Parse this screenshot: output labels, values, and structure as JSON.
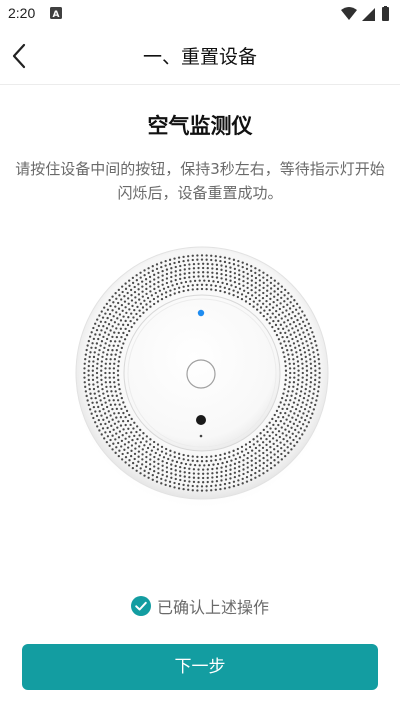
{
  "status_bar": {
    "time": "2:20",
    "notification_icon": "a-box-icon",
    "wifi_icon": "wifi-icon",
    "signal_icon": "cell-signal-icon",
    "battery_icon": "battery-icon"
  },
  "header": {
    "back_icon": "chevron-left-icon",
    "title": "一、重置设备"
  },
  "main": {
    "device_title": "空气监测仪",
    "instruction": "请按住设备中间的按钮，保持3秒左右，等待指示灯开始闪烁后，设备重置成功。",
    "device_image": "air-monitor-device-image"
  },
  "confirm": {
    "checked": true,
    "label": "已确认上述操作"
  },
  "next_button": {
    "label": "下一步"
  },
  "colors": {
    "accent": "#139da1",
    "indicator_blue": "#1f8cf0",
    "text_primary": "#111111",
    "text_secondary": "#6a6a6a"
  }
}
